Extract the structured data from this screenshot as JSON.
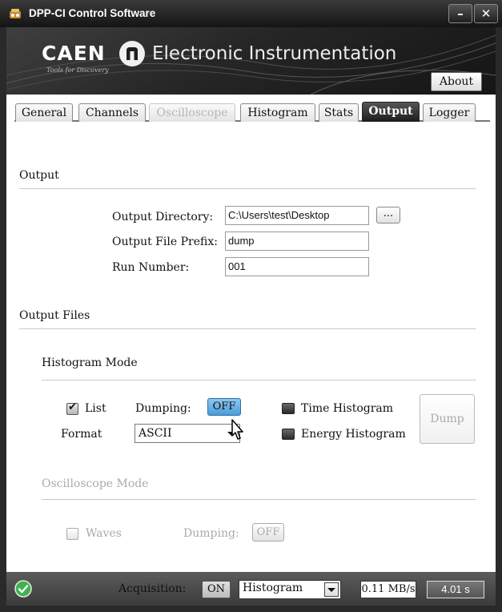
{
  "window": {
    "title": "DPP-CI Control Software",
    "minimize_glyph": "–",
    "close_glyph": "✕"
  },
  "banner": {
    "logo_text": "CAEN",
    "logo_tagline": "Tools for Discovery",
    "brand_text": "Electronic Instrumentation",
    "about_label": "About"
  },
  "tabs": [
    {
      "label": "General",
      "state": "normal"
    },
    {
      "label": "Channels",
      "state": "normal"
    },
    {
      "label": "Oscilloscope",
      "state": "disabled"
    },
    {
      "label": "Histogram",
      "state": "normal"
    },
    {
      "label": "Stats",
      "state": "normal"
    },
    {
      "label": "Output",
      "state": "active"
    },
    {
      "label": "Logger",
      "state": "normal"
    }
  ],
  "output": {
    "section_title": "Output",
    "directory_label": "Output Directory:",
    "directory_value": "C:\\Users\\test\\Desktop",
    "browse_label": "...",
    "prefix_label": "Output File Prefix:",
    "prefix_value": "dump",
    "run_label": "Run Number:",
    "run_value": "001"
  },
  "output_files": {
    "section_title": "Output Files",
    "histogram_mode": {
      "title": "Histogram Mode",
      "list_label": "List",
      "list_checked": true,
      "dumping_label": "Dumping:",
      "dumping_state": "OFF",
      "format_label": "Format",
      "format_value": "ASCII",
      "time_histogram_label": "Time Histogram",
      "energy_histogram_label": "Energy Histogram",
      "dump_button_label": "Dump"
    },
    "oscilloscope_mode": {
      "title": "Oscilloscope Mode",
      "waves_label": "Waves",
      "waves_checked": false,
      "dumping_label": "Dumping:",
      "dumping_state": "OFF"
    }
  },
  "status": {
    "acquisition_label": "Acquisition:",
    "acquisition_state": "ON",
    "mode_value": "Histogram",
    "rate": "0.11 MB/s",
    "elapsed": "4.01 s"
  },
  "icons": {
    "app": "app-icon",
    "status_ok": "check-circle-icon",
    "cursor": "mouse-pointer-icon"
  },
  "colors": {
    "active_tab": "#2a2a2a",
    "dumping_button": "#5aa9e6",
    "status_ok": "#37b24d"
  }
}
